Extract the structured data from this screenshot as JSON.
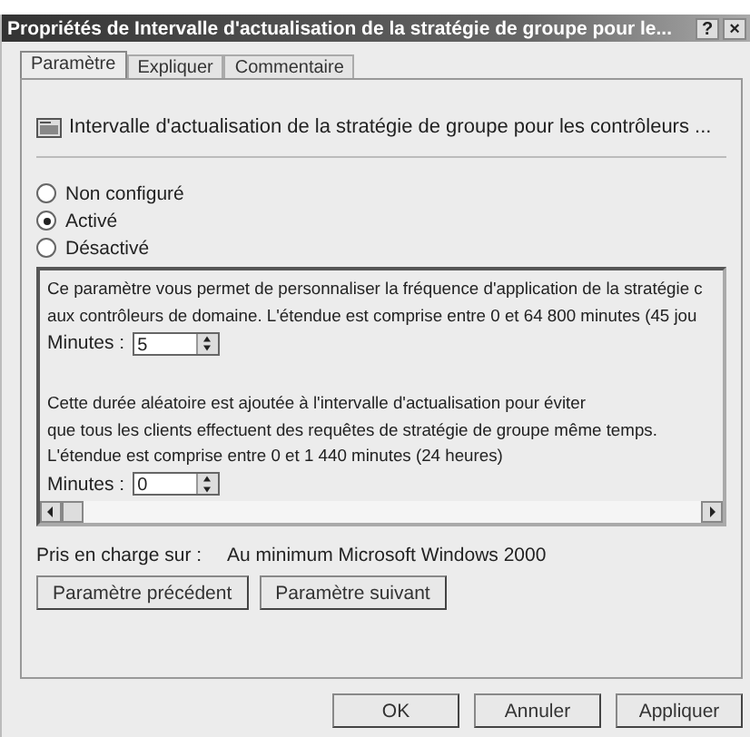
{
  "window": {
    "title": "Propriétés de Intervalle d'actualisation de la stratégie de groupe pour le...",
    "help": "?",
    "close": "×"
  },
  "tabs": [
    {
      "label": "Paramètre",
      "selected": true
    },
    {
      "label": "Expliquer",
      "selected": false
    },
    {
      "label": "Commentaire",
      "selected": false
    }
  ],
  "policy_name": "Intervalle d'actualisation de la stratégie de groupe pour les contrôleurs ...",
  "options": [
    {
      "label": "Non configuré",
      "selected": false
    },
    {
      "label": "Activé",
      "selected": true
    },
    {
      "label": "Désactivé",
      "selected": false
    }
  ],
  "settings": [
    {
      "kind": "text",
      "text": "Ce paramètre vous permet de personnaliser la fréquence d'application de la stratégie c"
    },
    {
      "kind": "text",
      "text": "aux contrôleurs de domaine. L'étendue est comprise entre 0 et 64 800 minutes (45 jou"
    },
    {
      "kind": "spin",
      "label": "Minutes :",
      "value": "5"
    },
    {
      "kind": "text",
      "text": "Cette durée aléatoire est ajoutée à l'intervalle d'actualisation pour éviter"
    },
    {
      "kind": "text",
      "text": "que tous les clients effectuent des requêtes de stratégie de groupe même temps."
    },
    {
      "kind": "text",
      "text": "L'étendue est comprise entre 0 et 1 440 minutes (24 heures)"
    },
    {
      "kind": "spin",
      "label": "Minutes :",
      "value": "0"
    }
  ],
  "supported_on": {
    "label": "Pris en charge sur :",
    "value": "Au minimum Microsoft Windows 2000"
  },
  "nav_buttons": [
    "Paramètre précédent",
    "Paramètre suivant"
  ],
  "buttons": [
    "OK",
    "Annuler",
    "Appliquer"
  ]
}
